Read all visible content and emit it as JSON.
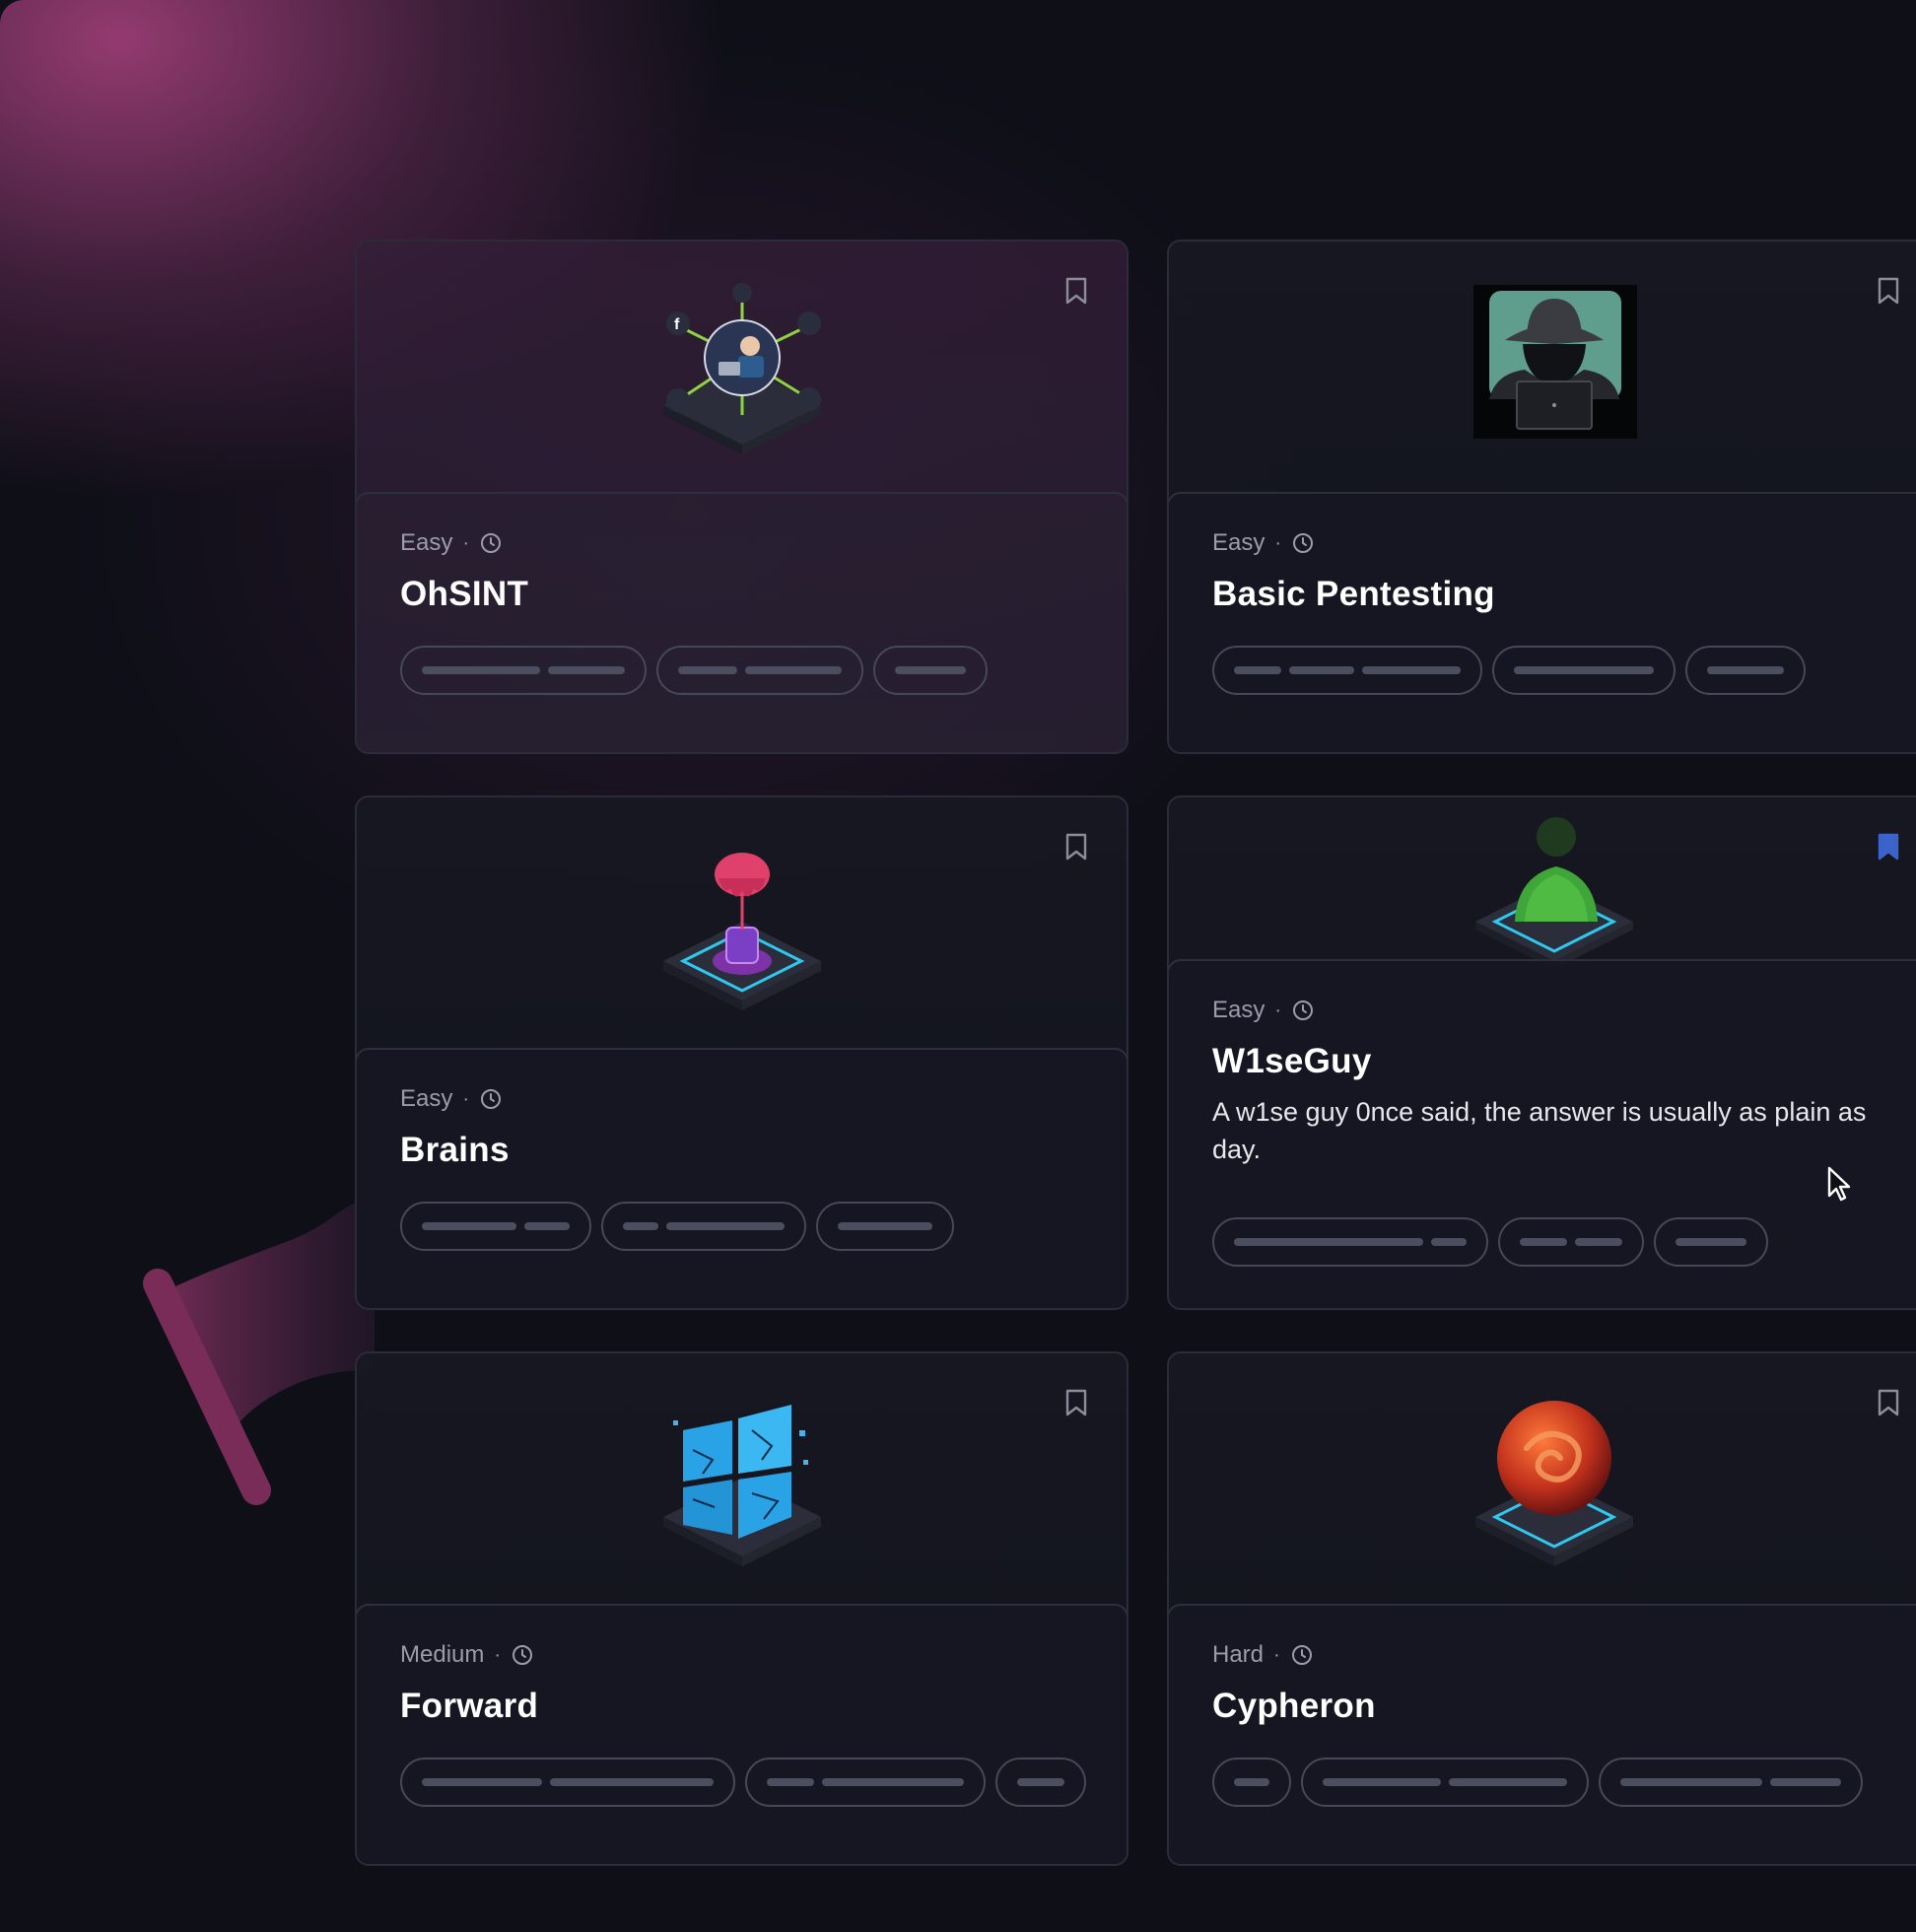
{
  "rooms": [
    {
      "id": "ohsint",
      "difficulty": "Easy",
      "separator": "·",
      "name": "OhSINT",
      "description": "",
      "bookmarked": false,
      "icon": "osint-social-network-icon",
      "tags": [
        [
          120,
          78
        ],
        [
          60,
          98
        ],
        [
          72
        ]
      ]
    },
    {
      "id": "basic-pentesting",
      "difficulty": "Easy",
      "separator": "·",
      "name": "Basic Pentesting",
      "description": "",
      "bookmarked": false,
      "icon": "hacker-with-laptop-icon",
      "tags": [
        [
          48,
          66,
          100
        ],
        [
          142
        ],
        [
          78
        ]
      ]
    },
    {
      "id": "brains",
      "difficulty": "Easy",
      "separator": "·",
      "name": "Brains",
      "description": "",
      "bookmarked": false,
      "icon": "brain-on-platform-icon",
      "tags": [
        [
          96,
          46
        ],
        [
          36,
          120
        ],
        [
          96
        ]
      ]
    },
    {
      "id": "w1seguy",
      "difficulty": "Easy",
      "separator": "·",
      "name": "W1seGuy",
      "description": "A w1se guy 0nce said, the answer is usually as plain as day.",
      "bookmarked": true,
      "icon": "matrix-person-icon",
      "tags": [
        [
          192,
          36
        ],
        [
          48,
          48
        ],
        [
          72
        ]
      ]
    },
    {
      "id": "forward",
      "difficulty": "Medium",
      "separator": "·",
      "name": "Forward",
      "description": "",
      "bookmarked": false,
      "icon": "broken-window-icon",
      "tags": [
        [
          122,
          166
        ],
        [
          48,
          144
        ],
        [
          48
        ]
      ]
    },
    {
      "id": "cypheron",
      "difficulty": "Hard",
      "separator": "·",
      "name": "Cypheron",
      "description": "",
      "bookmarked": false,
      "icon": "swirl-orb-icon",
      "tags": [
        [
          36
        ],
        [
          120,
          120
        ],
        [
          144,
          72
        ]
      ]
    }
  ],
  "colors": {
    "bookmark_active": "#3b63c9",
    "bookmark_inactive": "#8b8d9b",
    "tag_bar": "#4b4e5e",
    "platform_glow": "#2fc9f0"
  }
}
